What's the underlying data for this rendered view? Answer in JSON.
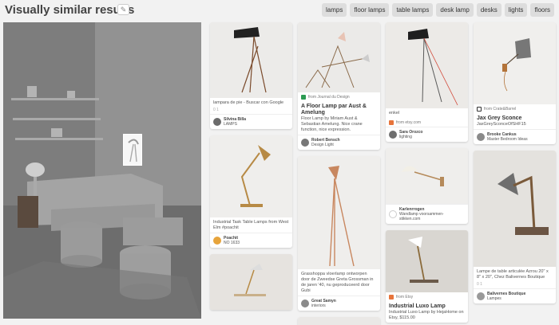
{
  "header": {
    "title": "Visually similar results",
    "tags": [
      "lamps",
      "floor lamps",
      "table lamps",
      "desk lamp",
      "desks",
      "lights",
      "floors"
    ]
  },
  "pins": {
    "c1p1": {
      "desc": "lampara de pie - Buscar con Google",
      "meta": "0 1",
      "user": "Silvina Billa",
      "board": "LAMPS"
    },
    "c1p2": {
      "desc": "Industrial Task Table Lamps from West Elm #poachit",
      "user": "Poachit",
      "board": "NO 1633"
    },
    "c2p1": {
      "source": "from Journal du Design",
      "title": "A Floor Lamp par Aust & Amelung",
      "desc": "Floor Lamp by Miriam Aust & Sebastian Amelung. Nice crane function, nice expression.",
      "user": "Robert Bensch",
      "board": "Design Light"
    },
    "c2p2": {
      "desc": "Grasshoppa vloerlamp ontworpen door de Zweedse Greta Grossman in de jaren '40, nu geproduceerd door Gubi",
      "user": "Great Samyn",
      "board": "interiors"
    },
    "c3p1": {
      "desc": "enkel",
      "source": "from etsy.com",
      "user": "Sara Orozco",
      "board": "lighting"
    },
    "c3p2": {
      "user": "Karlenrrogen",
      "board": "Wandlamp voorsammen-stikken.com"
    },
    "c3p3": {
      "source": "from Etsy",
      "title": "Industrial Luxo Lamp",
      "desc": "Industrial Luxo Lamp by HejaHome on Etsy, $115.00"
    },
    "c4p1": {
      "source": "from Crate&Barrel",
      "title": "Jax Grey Sconce",
      "desc": "JaxGreySconceOfSHF15",
      "user": "Brooke Cankus",
      "board": "Master Bedroom Ideas"
    },
    "c4p2": {
      "desc": "Lampe de table articulée Azrou 20\" x 8\" x 20\", Chez Balivernes Boutique",
      "meta": "0 1",
      "user": "Balivernes Boutique",
      "board": "Lampes"
    }
  }
}
